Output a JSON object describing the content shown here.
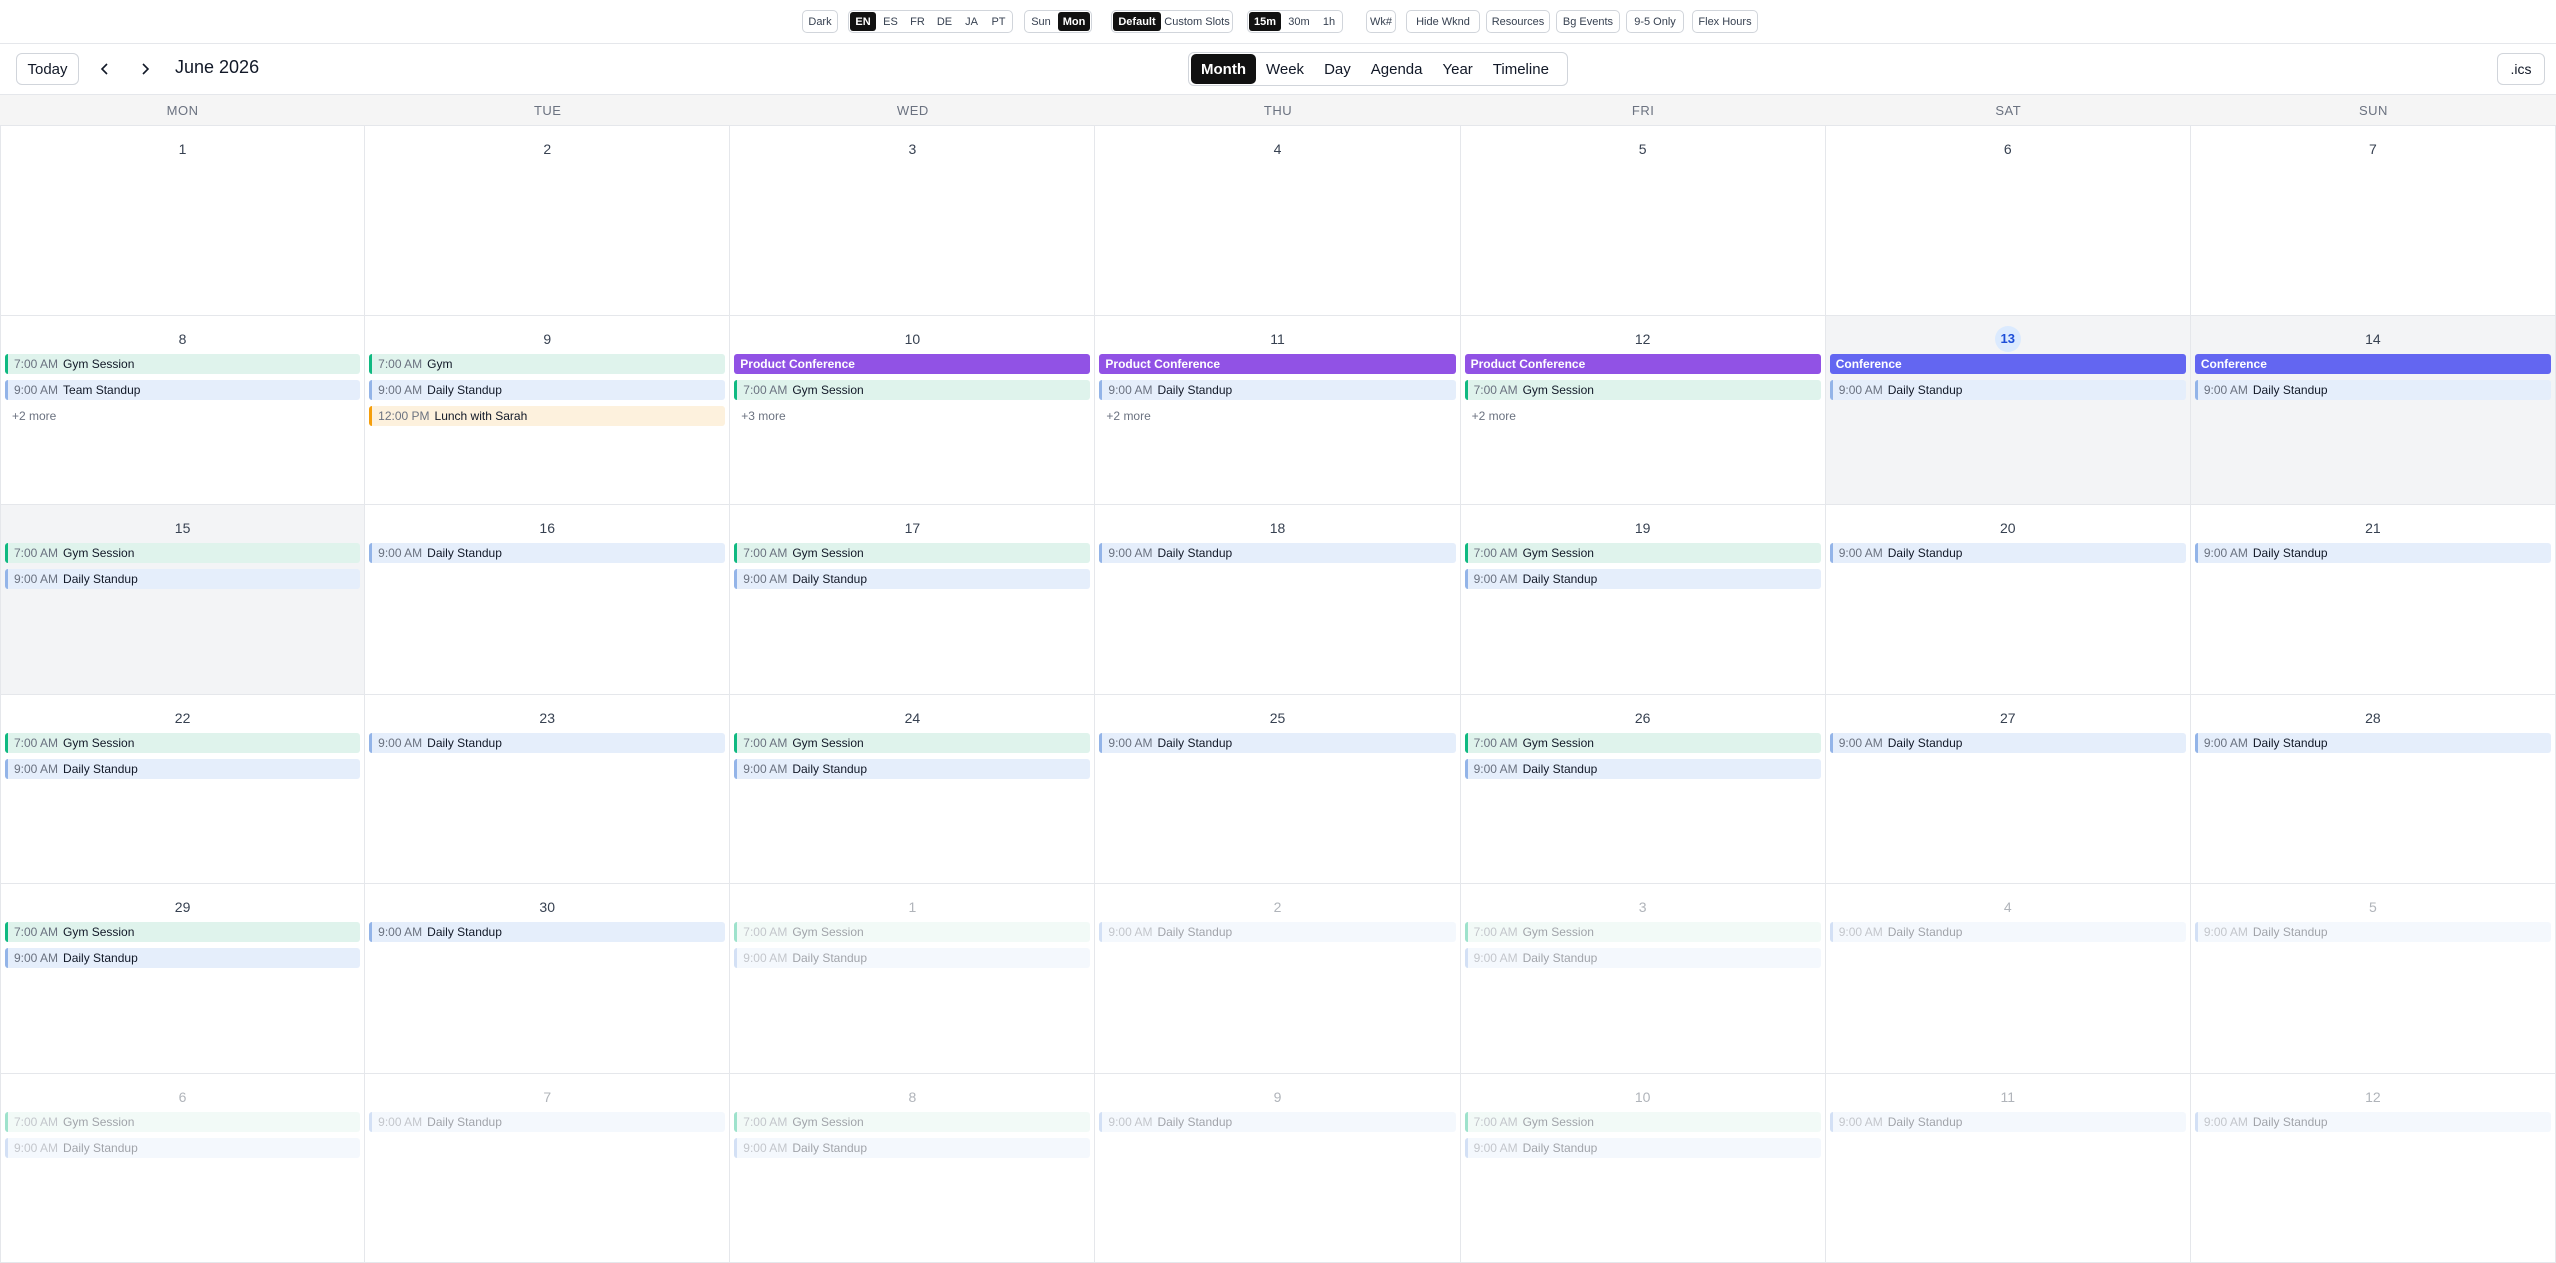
{
  "toolbar": {
    "theme": {
      "dark": "Dark"
    },
    "languages": [
      {
        "label": "EN",
        "active": true
      },
      {
        "label": "ES",
        "active": false
      },
      {
        "label": "FR",
        "active": false
      },
      {
        "label": "DE",
        "active": false
      },
      {
        "label": "JA",
        "active": false
      },
      {
        "label": "PT",
        "active": false
      }
    ],
    "week_start": [
      {
        "label": "Sun",
        "active": false
      },
      {
        "label": "Mon",
        "active": true
      }
    ],
    "slot_mode": [
      {
        "label": "Default",
        "active": true
      },
      {
        "label": "Custom Slots",
        "active": false
      }
    ],
    "slot_size": [
      {
        "label": "15m",
        "active": true
      },
      {
        "label": "30m",
        "active": false
      },
      {
        "label": "1h",
        "active": false
      }
    ],
    "toggles": {
      "week_numbers": "Wk#",
      "hide_weekends": "Hide Wknd",
      "resources": "Resources",
      "bg_events": "Bg Events",
      "nine_to_five": "9-5 Only",
      "flex_hours": "Flex Hours"
    }
  },
  "nav": {
    "today": "Today",
    "title": "June 2026",
    "views": [
      {
        "label": "Month",
        "active": true
      },
      {
        "label": "Week",
        "active": false
      },
      {
        "label": "Day",
        "active": false
      },
      {
        "label": "Agenda",
        "active": false
      },
      {
        "label": "Year",
        "active": false
      },
      {
        "label": "Timeline",
        "active": false
      }
    ],
    "export_label": ".ics"
  },
  "colors": {
    "green": "#10b981",
    "blue": "#93b4e8",
    "orange": "#f59e0b",
    "purple": "#9152e5",
    "indigo": "#6366f1",
    "today_highlight": "#dbeafe"
  },
  "weekdays": [
    "MON",
    "TUE",
    "WED",
    "THU",
    "FRI",
    "SAT",
    "SUN"
  ],
  "weeks": [
    [
      {
        "day": "1",
        "events": []
      },
      {
        "day": "2",
        "events": []
      },
      {
        "day": "3",
        "events": []
      },
      {
        "day": "4",
        "events": []
      },
      {
        "day": "5",
        "events": []
      },
      {
        "day": "6",
        "events": []
      },
      {
        "day": "7",
        "events": []
      }
    ],
    [
      {
        "day": "8",
        "events": [
          {
            "time": "7:00 AM",
            "title": "Gym Session",
            "color": "green"
          },
          {
            "time": "9:00 AM",
            "title": "Team Standup",
            "color": "blue"
          }
        ],
        "more": "+2 more"
      },
      {
        "day": "9",
        "events": [
          {
            "time": "7:00 AM",
            "title": "Gym",
            "color": "green"
          },
          {
            "time": "9:00 AM",
            "title": "Daily Standup",
            "color": "blue"
          },
          {
            "time": "12:00 PM",
            "title": "Lunch with Sarah",
            "color": "orange"
          }
        ]
      },
      {
        "day": "10",
        "events": [
          {
            "time": "",
            "title": "Product Conference",
            "color": "purple"
          },
          {
            "time": "7:00 AM",
            "title": "Gym Session",
            "color": "green"
          }
        ],
        "more": "+3 more"
      },
      {
        "day": "11",
        "events": [
          {
            "time": "",
            "title": "Product Conference",
            "color": "purple"
          },
          {
            "time": "9:00 AM",
            "title": "Daily Standup",
            "color": "blue"
          }
        ],
        "more": "+2 more"
      },
      {
        "day": "12",
        "events": [
          {
            "time": "",
            "title": "Product Conference",
            "color": "purple"
          },
          {
            "time": "7:00 AM",
            "title": "Gym Session",
            "color": "green"
          }
        ],
        "more": "+2 more"
      },
      {
        "day": "13",
        "today": true,
        "weekend": true,
        "events": [
          {
            "time": "",
            "title": "Conference",
            "color": "indigo"
          },
          {
            "time": "9:00 AM",
            "title": "Daily Standup",
            "color": "blue"
          }
        ]
      },
      {
        "day": "14",
        "weekend": true,
        "events": [
          {
            "time": "",
            "title": "Conference",
            "color": "indigo"
          },
          {
            "time": "9:00 AM",
            "title": "Daily Standup",
            "color": "blue"
          }
        ]
      }
    ],
    [
      {
        "day": "15",
        "weekend": true,
        "events": [
          {
            "time": "7:00 AM",
            "title": "Gym Session",
            "color": "green"
          },
          {
            "time": "9:00 AM",
            "title": "Daily Standup",
            "color": "blue"
          }
        ]
      },
      {
        "day": "16",
        "events": [
          {
            "time": "9:00 AM",
            "title": "Daily Standup",
            "color": "blue"
          }
        ]
      },
      {
        "day": "17",
        "events": [
          {
            "time": "7:00 AM",
            "title": "Gym Session",
            "color": "green"
          },
          {
            "time": "9:00 AM",
            "title": "Daily Standup",
            "color": "blue"
          }
        ]
      },
      {
        "day": "18",
        "events": [
          {
            "time": "9:00 AM",
            "title": "Daily Standup",
            "color": "blue"
          }
        ]
      },
      {
        "day": "19",
        "events": [
          {
            "time": "7:00 AM",
            "title": "Gym Session",
            "color": "green"
          },
          {
            "time": "9:00 AM",
            "title": "Daily Standup",
            "color": "blue"
          }
        ]
      },
      {
        "day": "20",
        "events": [
          {
            "time": "9:00 AM",
            "title": "Daily Standup",
            "color": "blue"
          }
        ]
      },
      {
        "day": "21",
        "events": [
          {
            "time": "9:00 AM",
            "title": "Daily Standup",
            "color": "blue"
          }
        ]
      }
    ],
    [
      {
        "day": "22",
        "events": [
          {
            "time": "7:00 AM",
            "title": "Gym Session",
            "color": "green"
          },
          {
            "time": "9:00 AM",
            "title": "Daily Standup",
            "color": "blue"
          }
        ]
      },
      {
        "day": "23",
        "events": [
          {
            "time": "9:00 AM",
            "title": "Daily Standup",
            "color": "blue"
          }
        ]
      },
      {
        "day": "24",
        "events": [
          {
            "time": "7:00 AM",
            "title": "Gym Session",
            "color": "green"
          },
          {
            "time": "9:00 AM",
            "title": "Daily Standup",
            "color": "blue"
          }
        ]
      },
      {
        "day": "25",
        "events": [
          {
            "time": "9:00 AM",
            "title": "Daily Standup",
            "color": "blue"
          }
        ]
      },
      {
        "day": "26",
        "events": [
          {
            "time": "7:00 AM",
            "title": "Gym Session",
            "color": "green"
          },
          {
            "time": "9:00 AM",
            "title": "Daily Standup",
            "color": "blue"
          }
        ]
      },
      {
        "day": "27",
        "events": [
          {
            "time": "9:00 AM",
            "title": "Daily Standup",
            "color": "blue"
          }
        ]
      },
      {
        "day": "28",
        "events": [
          {
            "time": "9:00 AM",
            "title": "Daily Standup",
            "color": "blue"
          }
        ]
      }
    ],
    [
      {
        "day": "29",
        "events": [
          {
            "time": "7:00 AM",
            "title": "Gym Session",
            "color": "green"
          },
          {
            "time": "9:00 AM",
            "title": "Daily Standup",
            "color": "blue"
          }
        ]
      },
      {
        "day": "30",
        "events": [
          {
            "time": "9:00 AM",
            "title": "Daily Standup",
            "color": "blue"
          }
        ]
      },
      {
        "day": "1",
        "outside": true,
        "events": [
          {
            "time": "7:00 AM",
            "title": "Gym Session",
            "color": "green"
          },
          {
            "time": "9:00 AM",
            "title": "Daily Standup",
            "color": "blue"
          }
        ]
      },
      {
        "day": "2",
        "outside": true,
        "events": [
          {
            "time": "9:00 AM",
            "title": "Daily Standup",
            "color": "blue"
          }
        ]
      },
      {
        "day": "3",
        "outside": true,
        "events": [
          {
            "time": "7:00 AM",
            "title": "Gym Session",
            "color": "green"
          },
          {
            "time": "9:00 AM",
            "title": "Daily Standup",
            "color": "blue"
          }
        ]
      },
      {
        "day": "4",
        "outside": true,
        "events": [
          {
            "time": "9:00 AM",
            "title": "Daily Standup",
            "color": "blue"
          }
        ]
      },
      {
        "day": "5",
        "outside": true,
        "events": [
          {
            "time": "9:00 AM",
            "title": "Daily Standup",
            "color": "blue"
          }
        ]
      }
    ],
    [
      {
        "day": "6",
        "outside": true,
        "events": [
          {
            "time": "7:00 AM",
            "title": "Gym Session",
            "color": "green"
          },
          {
            "time": "9:00 AM",
            "title": "Daily Standup",
            "color": "blue"
          }
        ]
      },
      {
        "day": "7",
        "outside": true,
        "events": [
          {
            "time": "9:00 AM",
            "title": "Daily Standup",
            "color": "blue"
          }
        ]
      },
      {
        "day": "8",
        "outside": true,
        "events": [
          {
            "time": "7:00 AM",
            "title": "Gym Session",
            "color": "green"
          },
          {
            "time": "9:00 AM",
            "title": "Daily Standup",
            "color": "blue"
          }
        ]
      },
      {
        "day": "9",
        "outside": true,
        "events": [
          {
            "time": "9:00 AM",
            "title": "Daily Standup",
            "color": "blue"
          }
        ]
      },
      {
        "day": "10",
        "outside": true,
        "events": [
          {
            "time": "7:00 AM",
            "title": "Gym Session",
            "color": "green"
          },
          {
            "time": "9:00 AM",
            "title": "Daily Standup",
            "color": "blue"
          }
        ]
      },
      {
        "day": "11",
        "outside": true,
        "events": [
          {
            "time": "9:00 AM",
            "title": "Daily Standup",
            "color": "blue"
          }
        ]
      },
      {
        "day": "12",
        "outside": true,
        "events": [
          {
            "time": "9:00 AM",
            "title": "Daily Standup",
            "color": "blue"
          }
        ]
      }
    ]
  ]
}
